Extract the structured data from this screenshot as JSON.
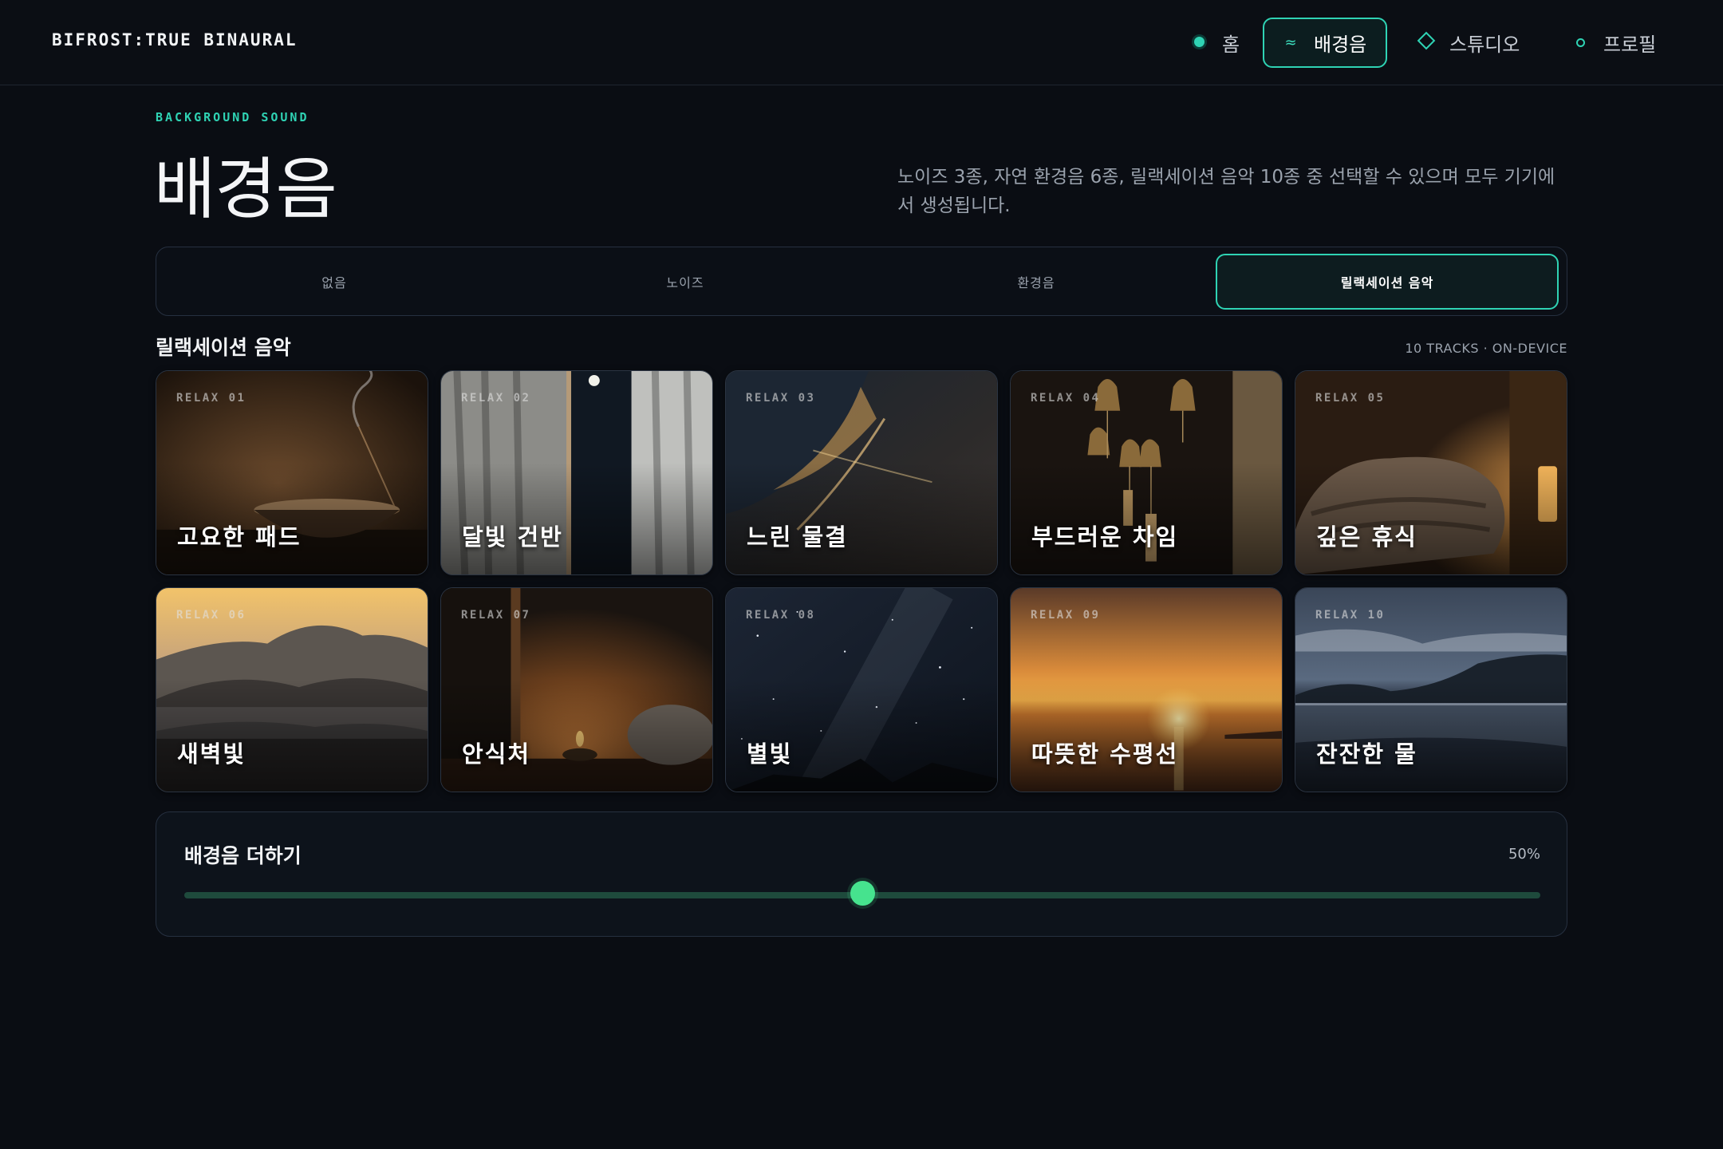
{
  "brand": "BIFROST:TRUE BINAURAL",
  "nav": [
    {
      "label": "홈",
      "icon": "dot-icon"
    },
    {
      "label": "배경음",
      "icon": "wave-icon",
      "glyph": "≈"
    },
    {
      "label": "스튜디오",
      "icon": "diamond-icon"
    },
    {
      "label": "프로필",
      "icon": "ring-icon"
    }
  ],
  "header": {
    "eyebrow": "BACKGROUND SOUND",
    "title": "배경음",
    "description": "노이즈 3종, 자연 환경음 6종, 릴랙세이션 음악 10종 중 선택할 수 있으며 모두 기기에서 생성됩니다."
  },
  "tabs": [
    "없음",
    "노이즈",
    "환경음",
    "릴랙세이션 음악"
  ],
  "active_tab": "릴랙세이션 음악",
  "section": {
    "title": "릴랙세이션 음악",
    "meta": "10 TRACKS · ON-DEVICE"
  },
  "tracks": [
    {
      "code": "RELAX 01",
      "name": "고요한 패드"
    },
    {
      "code": "RELAX 02",
      "name": "달빛 건반"
    },
    {
      "code": "RELAX 03",
      "name": "느린 물결"
    },
    {
      "code": "RELAX 04",
      "name": "부드러운 차임"
    },
    {
      "code": "RELAX 05",
      "name": "깊은 휴식"
    },
    {
      "code": "RELAX 06",
      "name": "새벽빛"
    },
    {
      "code": "RELAX 07",
      "name": "안식처"
    },
    {
      "code": "RELAX 08",
      "name": "별빛"
    },
    {
      "code": "RELAX 09",
      "name": "따뜻한 수평선"
    },
    {
      "code": "RELAX 10",
      "name": "잔잔한 물"
    }
  ],
  "mix": {
    "label": "배경음 더하기",
    "value_text": "50%",
    "value": 0.5
  },
  "colors": {
    "accent": "#2fd3b4",
    "slider": "#46e38e",
    "background": "#0a0d13"
  }
}
